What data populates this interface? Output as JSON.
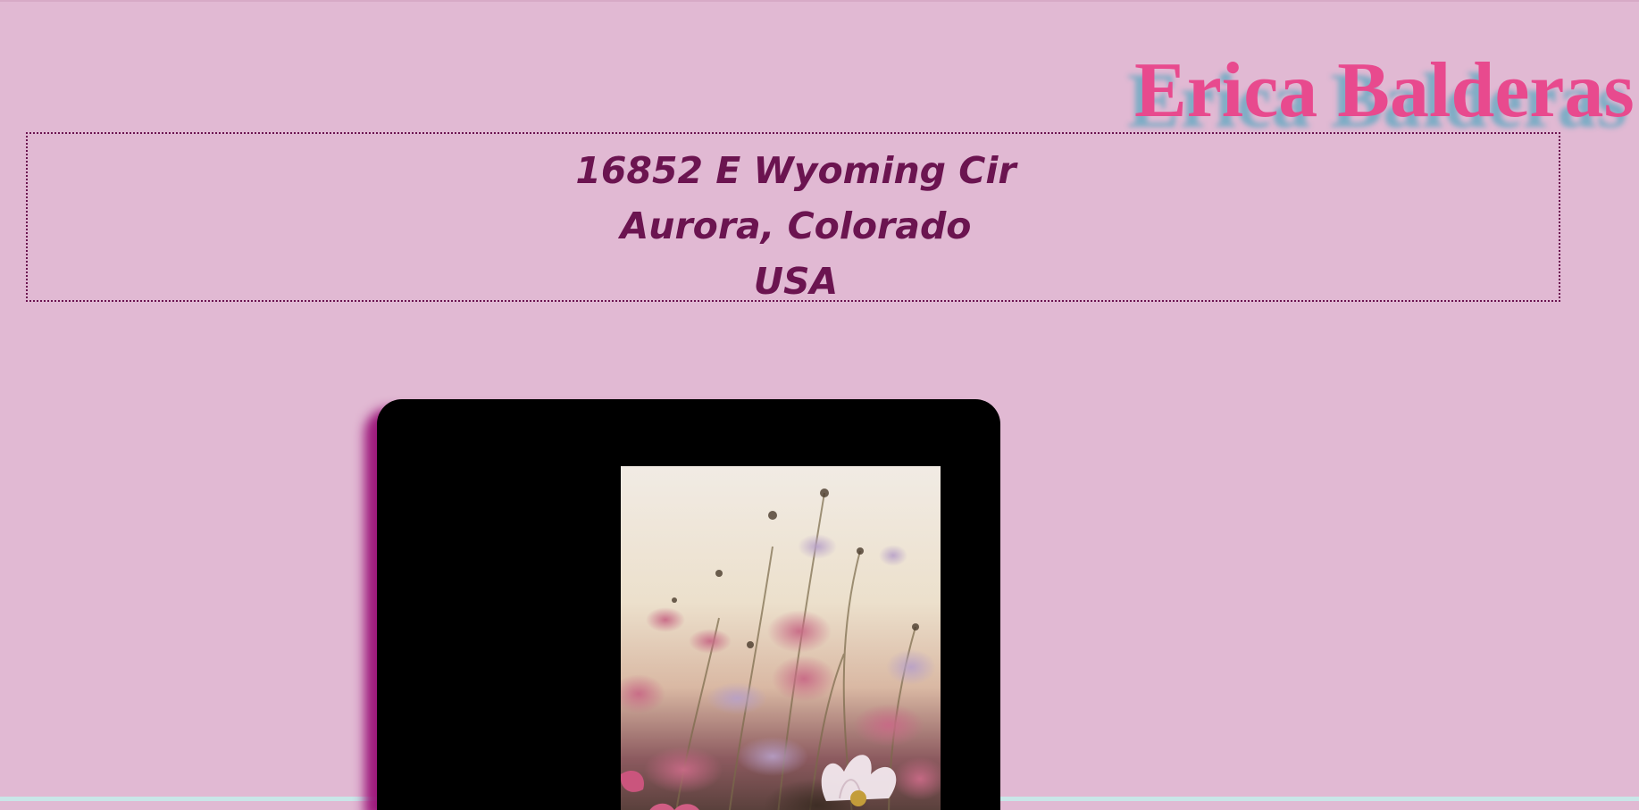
{
  "header": {
    "name": "Erica Balderas"
  },
  "address": {
    "line1": "16852 E Wyoming Cir",
    "line2": "Aurora, Colorado",
    "line3": "USA"
  },
  "photo": {
    "subject": "cosmos-flowers-photo"
  },
  "colors": {
    "background": "#e1b9d3",
    "name_text": "#e84a8e",
    "name_shadow": "#6eaac3",
    "address_text": "#6b1450",
    "card": "#000000",
    "card_shadow": "#9b1278"
  }
}
